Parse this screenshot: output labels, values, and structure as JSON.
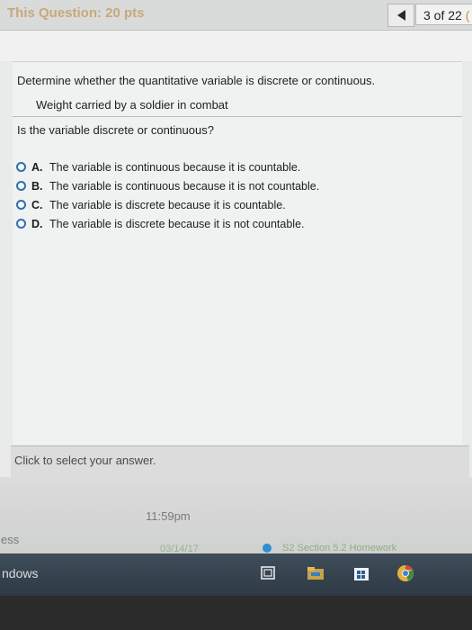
{
  "header": {
    "question_points": "This Question: 20 pts",
    "pager_text": "3 of 22",
    "pager_cut": "("
  },
  "question": {
    "prompt": "Determine whether the quantitative variable is discrete or continuous.",
    "item": "Weight carried by a soldier in combat",
    "ask": "Is the variable discrete or continuous?",
    "options": [
      {
        "letter": "A.",
        "text": "The variable is continuous because it is countable."
      },
      {
        "letter": "B.",
        "text": "The variable is continuous because it is not countable."
      },
      {
        "letter": "C.",
        "text": "The variable is discrete because it is countable."
      },
      {
        "letter": "D.",
        "text": "The variable is discrete because it is not countable."
      }
    ]
  },
  "answer_bar": {
    "hint": "Click to select your answer."
  },
  "footer": {
    "due_time": "11:59pm",
    "left_cut": "ess",
    "date": "03/14/17",
    "assignment": "S2 Section 5.2 Homework"
  },
  "taskbar": {
    "left_text": "ndows",
    "icons": [
      "task-view-icon",
      "file-explorer-icon",
      "store-icon",
      "chrome-icon"
    ]
  },
  "colors": {
    "radio_border": "#2f6fb0",
    "points_text": "#c7a978",
    "taskbar_bg": "#34414d"
  }
}
